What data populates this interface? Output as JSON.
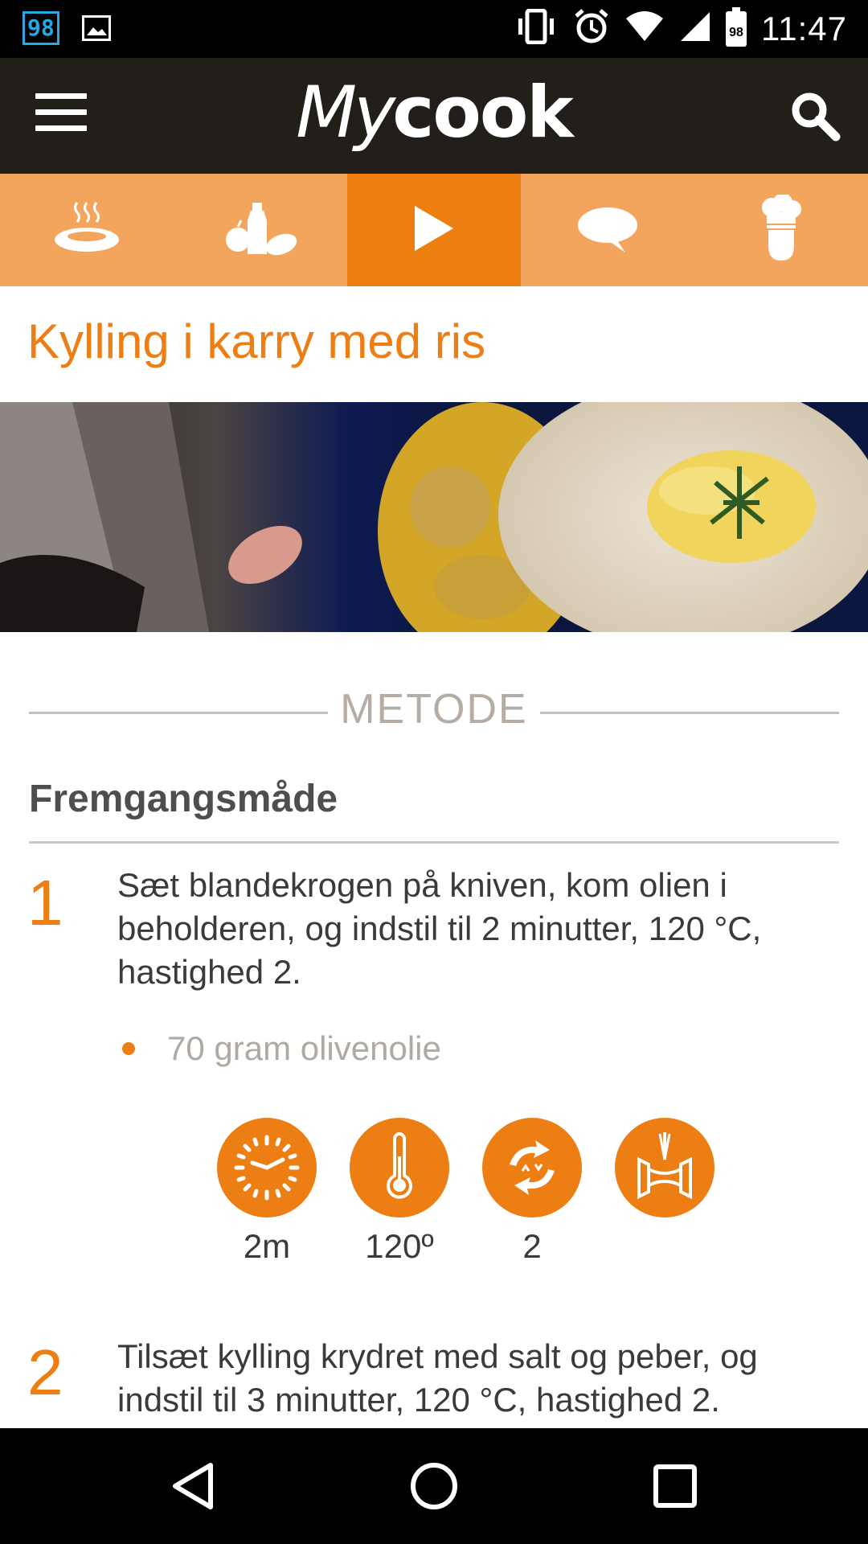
{
  "status_bar": {
    "notification_badge": "98",
    "battery_level": "98",
    "time": "11:47",
    "icons": [
      "image-icon",
      "vibrate-icon",
      "alarm-icon",
      "wifi-icon",
      "signal-icon",
      "battery-icon"
    ]
  },
  "app_bar": {
    "logo_my": "My",
    "logo_cook": "cook",
    "menu_icon": "hamburger-icon",
    "search_icon": "search-icon"
  },
  "tabs": [
    {
      "icon": "dish-icon",
      "active": false
    },
    {
      "icon": "ingredients-icon",
      "active": false
    },
    {
      "icon": "play-icon",
      "active": true
    },
    {
      "icon": "comment-icon",
      "active": false
    },
    {
      "icon": "chef-icon",
      "active": false
    }
  ],
  "recipe": {
    "title": "Kylling i karry med ris",
    "section_label": "METODE",
    "subheading": "Fremgangsmåde",
    "steps": [
      {
        "number": "1",
        "text": "Sæt blandekrogen på kniven, kom olien i beholderen, og indstil til 2 minutter, 120 °C, hastighed 2.",
        "ingredients": [
          "70 gram olivenolie"
        ],
        "settings": [
          {
            "icon": "timer-icon",
            "value": "2m"
          },
          {
            "icon": "thermometer-icon",
            "value": "120º"
          },
          {
            "icon": "speed-icon",
            "value": "2"
          },
          {
            "icon": "mixing-paddle-icon",
            "value": ""
          }
        ]
      },
      {
        "number": "2",
        "text": "Tilsæt kylling krydret med salt og peber, og indstil til 3 minutter, 120 °C, hastighed 2."
      }
    ]
  },
  "colors": {
    "accent": "#ec7e14",
    "tab_bar": "#f4a55d",
    "tab_active": "#ed7f10",
    "app_bar": "#221e1a"
  },
  "nav_bar": {
    "back_icon": "back-icon",
    "home_icon": "home-icon",
    "recents_icon": "recents-icon"
  }
}
